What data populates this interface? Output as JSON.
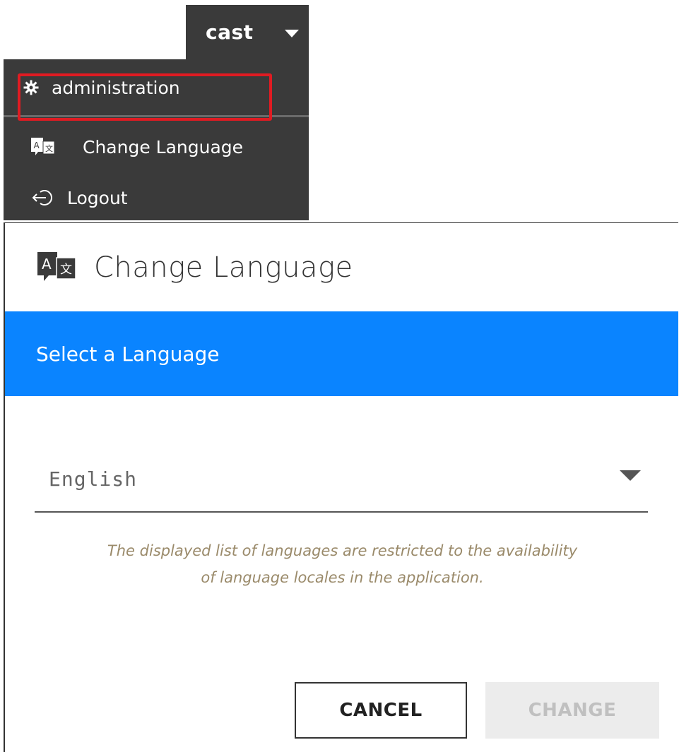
{
  "menu": {
    "user_name": "cast",
    "items": [
      {
        "label": "administration",
        "icon": "gear-icon"
      },
      {
        "label": "Change Language",
        "icon": "translate-icon",
        "highlighted": true
      },
      {
        "label": "Logout",
        "icon": "logout-icon"
      }
    ]
  },
  "dialog": {
    "title": "Change Language",
    "icon": "translate-icon",
    "section_header": "Select a Language",
    "language_select": {
      "selected": "English"
    },
    "note": [
      "The displayed list of languages are restricted to the availability",
      "of language locales in the application."
    ],
    "cancel_label": "CANCEL",
    "change_label": "CHANGE"
  },
  "colors": {
    "menu_bg": "#3a3a3a",
    "highlight": "#e01b22",
    "band_blue": "#0a84ff",
    "note_text": "#9a8a6a",
    "change_disabled_bg": "#ececec"
  }
}
